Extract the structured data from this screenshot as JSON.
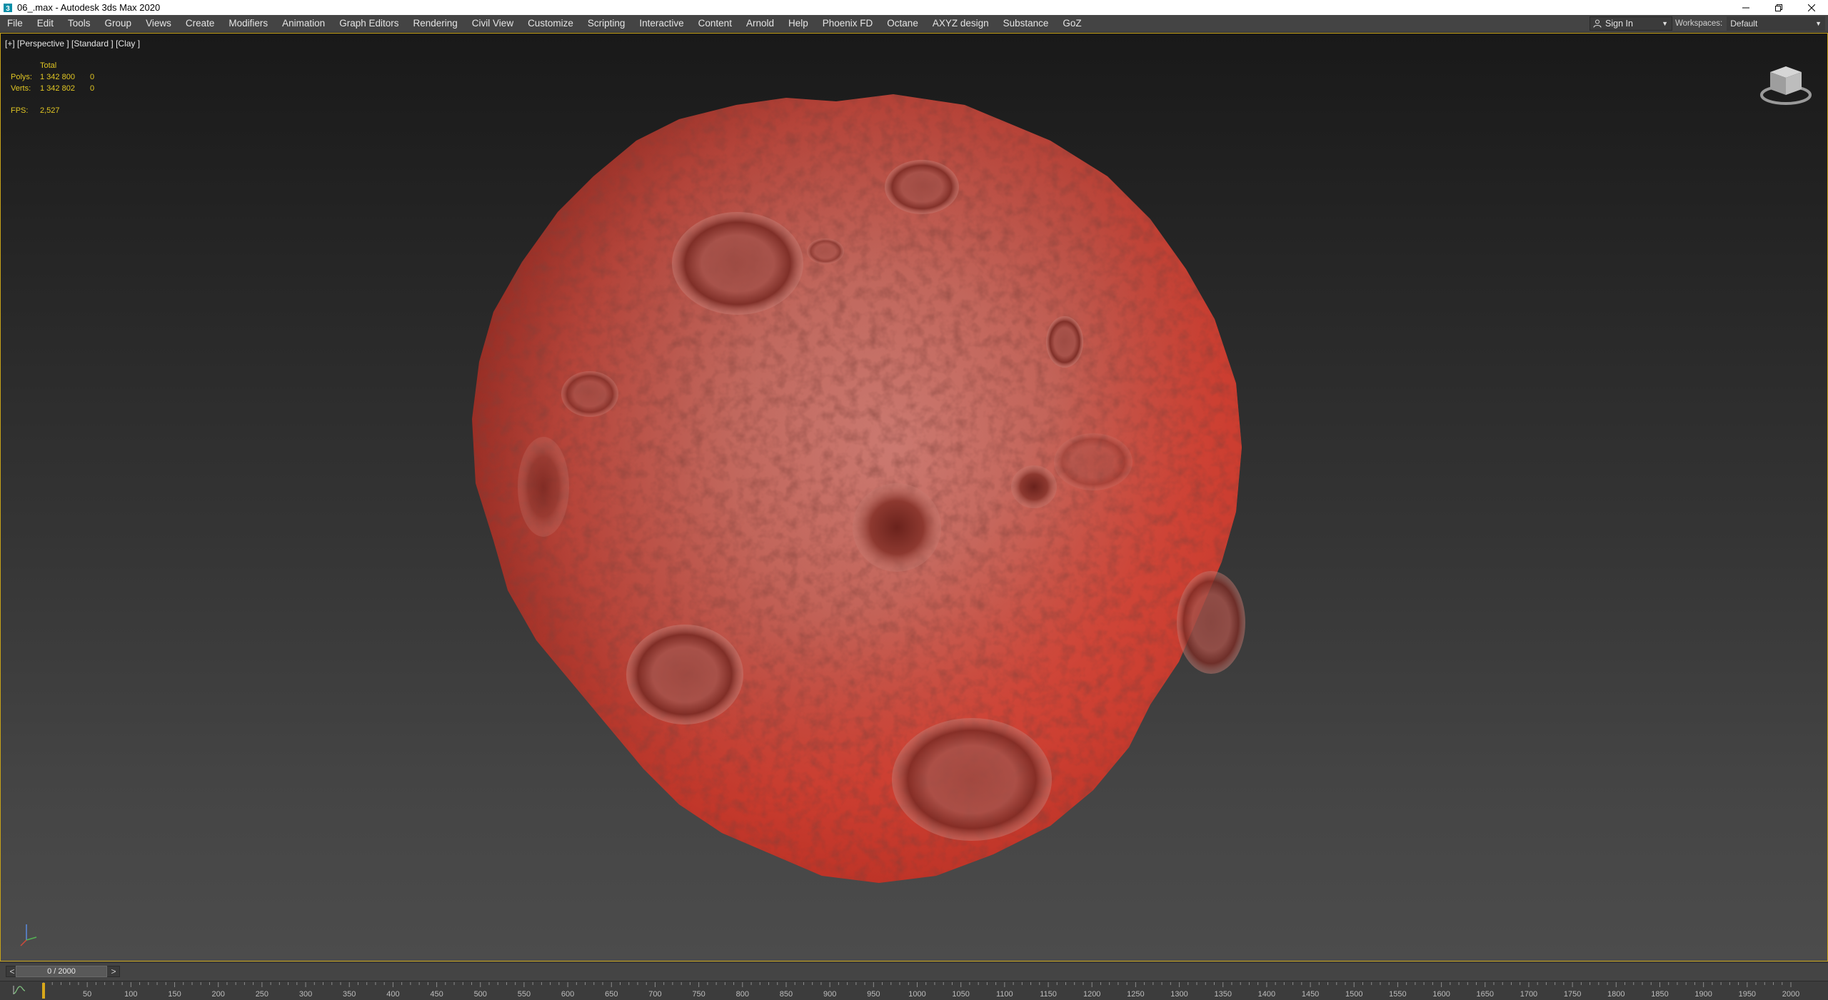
{
  "window": {
    "title": "06_.max - Autodesk 3ds Max 2020",
    "app_icon": "3ds-max-icon",
    "controls": [
      "minimize-icon",
      "restore-icon",
      "close-icon"
    ]
  },
  "menubar": {
    "items": [
      "File",
      "Edit",
      "Tools",
      "Group",
      "Views",
      "Create",
      "Modifiers",
      "Animation",
      "Graph Editors",
      "Rendering",
      "Civil View",
      "Customize",
      "Scripting",
      "Interactive",
      "Content",
      "Arnold",
      "Help",
      "Phoenix FD",
      "Octane",
      "AXYZ design",
      "Substance",
      "GoZ"
    ],
    "sign_in": "Sign In",
    "workspaces_label": "Workspaces:",
    "workspaces_value": "Default"
  },
  "viewport": {
    "label": "[+] [Perspective ] [Standard ] [Clay ]",
    "stats": {
      "header": "Total",
      "polys_label": "Polys:",
      "polys_total": "1 342 800",
      "polys_selected": "0",
      "verts_label": "Verts:",
      "verts_total": "1 342 802",
      "verts_selected": "0",
      "fps_label": "FPS:",
      "fps_value": "2,527"
    },
    "object": "asteroid-model",
    "object_color": "#b84a3f",
    "border_color": "#c6a219"
  },
  "timeslider": {
    "prev": "<",
    "next": ">",
    "frame_display": "0 / 2000",
    "current_frame": 0,
    "total_frames": 2000
  },
  "trackbar": {
    "icon": "curve-editor-icon",
    "ticks": [
      "50",
      "100",
      "150",
      "200",
      "250",
      "300",
      "350",
      "400",
      "450",
      "500",
      "550",
      "600",
      "650",
      "700",
      "750",
      "800",
      "850",
      "900",
      "950",
      "1000",
      "1050",
      "1100",
      "1150",
      "1200",
      "1250",
      "1300",
      "1350",
      "1400",
      "1450",
      "1500",
      "1550",
      "1600",
      "1650",
      "1700",
      "1750",
      "1800",
      "1850",
      "1900",
      "1950",
      "2000"
    ],
    "ruler_max": 2000
  }
}
